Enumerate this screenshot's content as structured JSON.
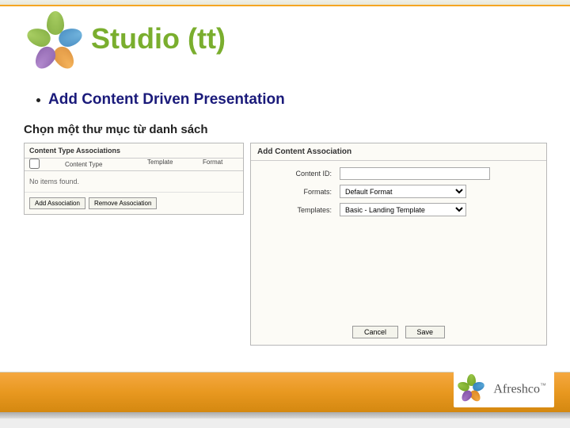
{
  "title": "Studio (tt)",
  "bullet": "Add Content Driven Presentation",
  "subtitle": "Chọn một thư mục từ danh sách",
  "leftPanel": {
    "title": "Content Type Associations",
    "headers": {
      "col2": "Content Type",
      "col3": "Template",
      "col4": "Format"
    },
    "empty": "No items found.",
    "buttons": {
      "add": "Add Association",
      "remove": "Remove Association"
    }
  },
  "rightPanel": {
    "title": "Add Content Association",
    "labels": {
      "contentId": "Content ID:",
      "formats": "Formats:",
      "templates": "Templates:"
    },
    "fields": {
      "contentId": "",
      "format": "Default Format",
      "template": "Basic - Landing Template"
    },
    "buttons": {
      "cancel": "Cancel",
      "save": "Save"
    }
  },
  "brand": {
    "name": "Afreshco",
    "tm": "™"
  }
}
